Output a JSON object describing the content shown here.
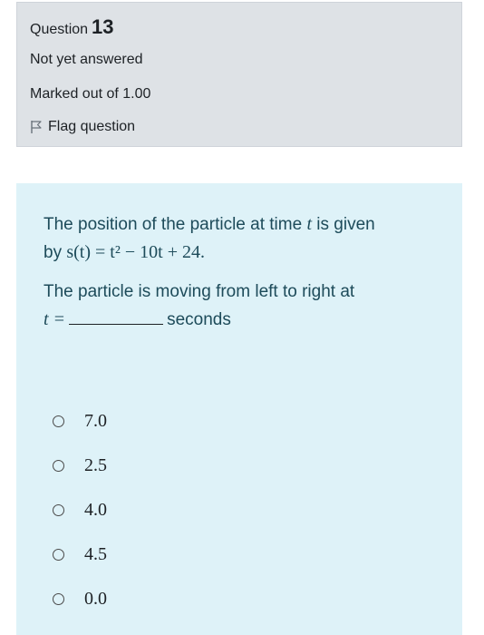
{
  "question": {
    "label": "Question",
    "number": "13",
    "state": "Not yet answered",
    "marks": "Marked out of 1.00",
    "flag_label": "Flag question"
  },
  "content": {
    "line1_pre": "The position of the particle at time ",
    "var_t": "t",
    "line1_post": " is given",
    "line2_pre": "by ",
    "equation": "s(t) = t² − 10t + 24.",
    "para2": "The particle is moving from left to right at",
    "t_equals": "t =",
    "seconds": "seconds"
  },
  "options": [
    {
      "label": "7.0"
    },
    {
      "label": "2.5"
    },
    {
      "label": "4.0"
    },
    {
      "label": "4.5"
    },
    {
      "label": "0.0"
    }
  ]
}
